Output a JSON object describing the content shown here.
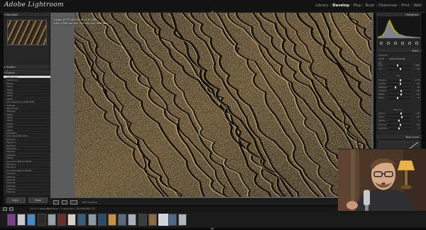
{
  "app": {
    "logo_text": "Adobe Lightroom",
    "modules": [
      "Library",
      "Develop",
      "Map",
      "Book",
      "Slideshow",
      "Print",
      "Web"
    ],
    "active_module": "Develop"
  },
  "left_panel": {
    "navigator_label": "Navigator",
    "presets_label": "Presets",
    "snapshots_label": "Snapshots",
    "history_label": "History",
    "history_items": [
      "Sharpening",
      "Sharpening",
      "Texture",
      "Clarity",
      "Clarity",
      "Clarity",
      "Clarity",
      "Clarity",
      "Color Reset Tone (RGB Shift)",
      "Shadows",
      "Split Toning",
      "Shadows",
      "Clarity",
      "Clarity",
      "Clarity",
      "Clarity",
      "Clarity",
      "Clarity",
      "Saturation",
      "Color Noise Reduction",
      "Exposure",
      "Exposure",
      "Exposure",
      "Highlights",
      "Shadows",
      "Shadows",
      "Whites",
      "Convert to Black & White",
      "Exposure",
      "Exposure",
      "Convert to Black & White",
      "Shadows",
      "Shadows",
      "Shadows",
      "Shadows",
      "Shadows",
      "Shadows",
      "Shadows",
      "Whites",
      "Shadows",
      "White Balance: As Shot",
      "Import"
    ],
    "copy_button": "Copy...",
    "paste_button": "Paste"
  },
  "photo_info": {
    "line1": "Canon EF 70-200 f/2.8L IS III USM",
    "line2": "f/8.0  1/250 sec  ISO 200  200 mm  ORIGINAL"
  },
  "toolbar": {
    "soft_proofing_label": "Soft Proofing"
  },
  "right_panel": {
    "histogram_label": "Histogram",
    "basic_label": "Basic",
    "treatment_label": "Treatment",
    "profile_label": "Profile",
    "profile_value": "Adobe Landscape",
    "wb_label": "WB",
    "tone_label": "Tone",
    "presence_label": "Presence",
    "tone_curve_label": "Tone Curve",
    "sliders": [
      {
        "label": "Temp",
        "value": "4850",
        "pos": 0.45
      },
      {
        "label": "Tint",
        "value": "+10",
        "pos": 0.55
      },
      {
        "label": "Exposure",
        "value": "+0.35",
        "pos": 0.55
      },
      {
        "label": "Contrast",
        "value": "+10",
        "pos": 0.55
      },
      {
        "label": "Highlights",
        "value": "-30",
        "pos": 0.35
      },
      {
        "label": "Shadows",
        "value": "+20",
        "pos": 0.6
      },
      {
        "label": "Whites",
        "value": "+15",
        "pos": 0.58
      },
      {
        "label": "Blacks",
        "value": "-10",
        "pos": 0.45
      },
      {
        "label": "Texture",
        "value": "+20",
        "pos": 0.6
      },
      {
        "label": "Clarity",
        "value": "+25",
        "pos": 0.62
      },
      {
        "label": "Dehaze",
        "value": "0",
        "pos": 0.5
      },
      {
        "label": "Vibrance",
        "value": "+10",
        "pos": 0.55
      },
      {
        "label": "Saturation",
        "value": "0",
        "pos": 0.5
      }
    ],
    "previous_button": "Previous",
    "reset_button": "Reset"
  },
  "filmstrip": {
    "source_text": "Quick Collection",
    "count_text": "1 photos / 1 selected / 3D4A8868.CR2",
    "filter_label": "Filter:"
  }
}
